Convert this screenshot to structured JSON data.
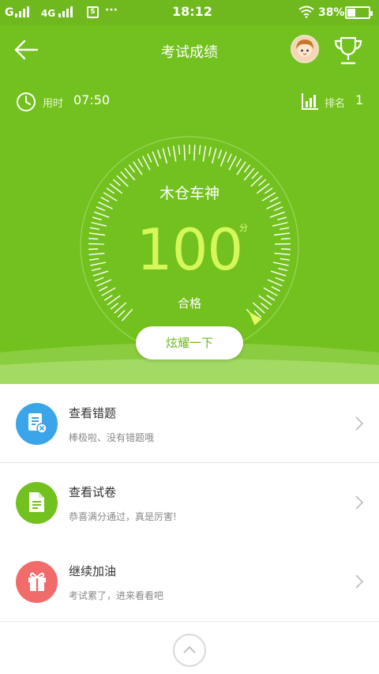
{
  "status_bar": {
    "carrier1": "G",
    "carrier2": "4G",
    "time": "18:12",
    "battery": "38%",
    "battery_level": 0.38,
    "more": "···"
  },
  "header": {
    "title": "考试成绩",
    "time_label": "用时",
    "time_value": "07:50",
    "rank_label": "排名",
    "rank_value": "1"
  },
  "result": {
    "username": "木仓车神",
    "score": "100",
    "score_unit": "分",
    "score_fraction": 1.0,
    "status": "合格",
    "share_label": "炫耀一下"
  },
  "list": [
    {
      "title": "查看错题",
      "subtitle": "棒极啦、没有错题哦",
      "icon": "wrong-questions-icon",
      "color": "#3aa5e8"
    },
    {
      "title": "查看试卷",
      "subtitle": "恭喜满分通过，真是厉害!",
      "icon": "paper-icon",
      "color": "#73c11f"
    },
    {
      "title": "继续加油",
      "subtitle": "考试累了，进来看看吧",
      "icon": "gift-icon",
      "color": "#f26b6b"
    }
  ],
  "colors": {
    "primary": "#73c11f",
    "score": "#d6f75a"
  }
}
